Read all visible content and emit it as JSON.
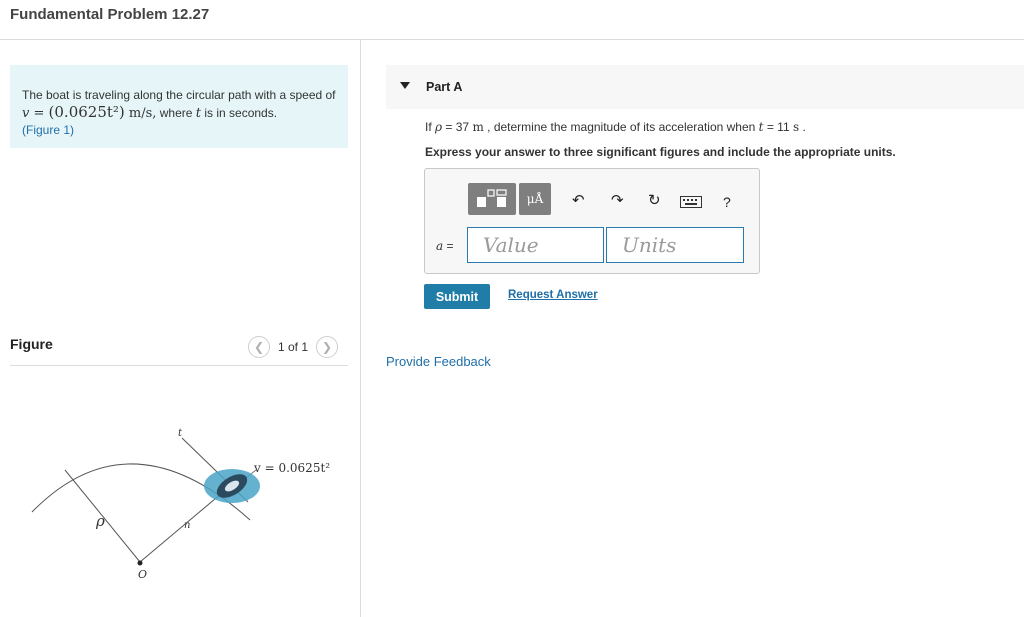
{
  "page": {
    "title": "Fundamental Problem 12.27"
  },
  "problem": {
    "text_before": "The boat is traveling along the circular path with a speed of ",
    "v_symbol": "v",
    "equals": " = ",
    "expression": "(0.0625t²)",
    "units": " m/s,",
    "text_where": " where ",
    "t_symbol": "t",
    "text_after": " is in seconds.",
    "figure_link": "(Figure 1)"
  },
  "figure": {
    "label": "Figure",
    "pager_text": "1 of 1",
    "prev_icon": "chevron-left-icon",
    "next_icon": "chevron-right-icon",
    "labels": {
      "t": "t",
      "n": "n",
      "rho": "ρ",
      "origin": "O",
      "velocity": "v = 0.0625t²"
    },
    "colors": {
      "water": "#4aa3c8",
      "line": "#555555"
    }
  },
  "part": {
    "title": "Part A",
    "caret_icon": "caret-down-icon"
  },
  "question": {
    "prefix": "If ",
    "rho": "ρ",
    "equals_value": " = 37 ",
    "unit": "m",
    "middle": " , determine the magnitude of its acceleration when ",
    "t": "t",
    "t_value": " = 11 ",
    "t_unit": "s",
    "suffix": " ."
  },
  "instruction": "Express your answer to three significant figures and include the appropriate units.",
  "toolbar": {
    "template_icon": "template-icon",
    "units_label": "μÅ",
    "undo_icon": "undo-icon",
    "redo_icon": "redo-icon",
    "reset_icon": "reset-icon",
    "keyboard_icon": "keyboard-icon",
    "help_label": "?"
  },
  "answer": {
    "variable": "a",
    "equals": " =",
    "value_placeholder": "Value",
    "units_placeholder": "Units"
  },
  "actions": {
    "submit": "Submit",
    "request_answer": "Request Answer",
    "provide_feedback": "Provide Feedback"
  },
  "colors": {
    "accent": "#1f7da8",
    "link": "#1f6fa8",
    "problem_bg": "#e6f6f8"
  }
}
